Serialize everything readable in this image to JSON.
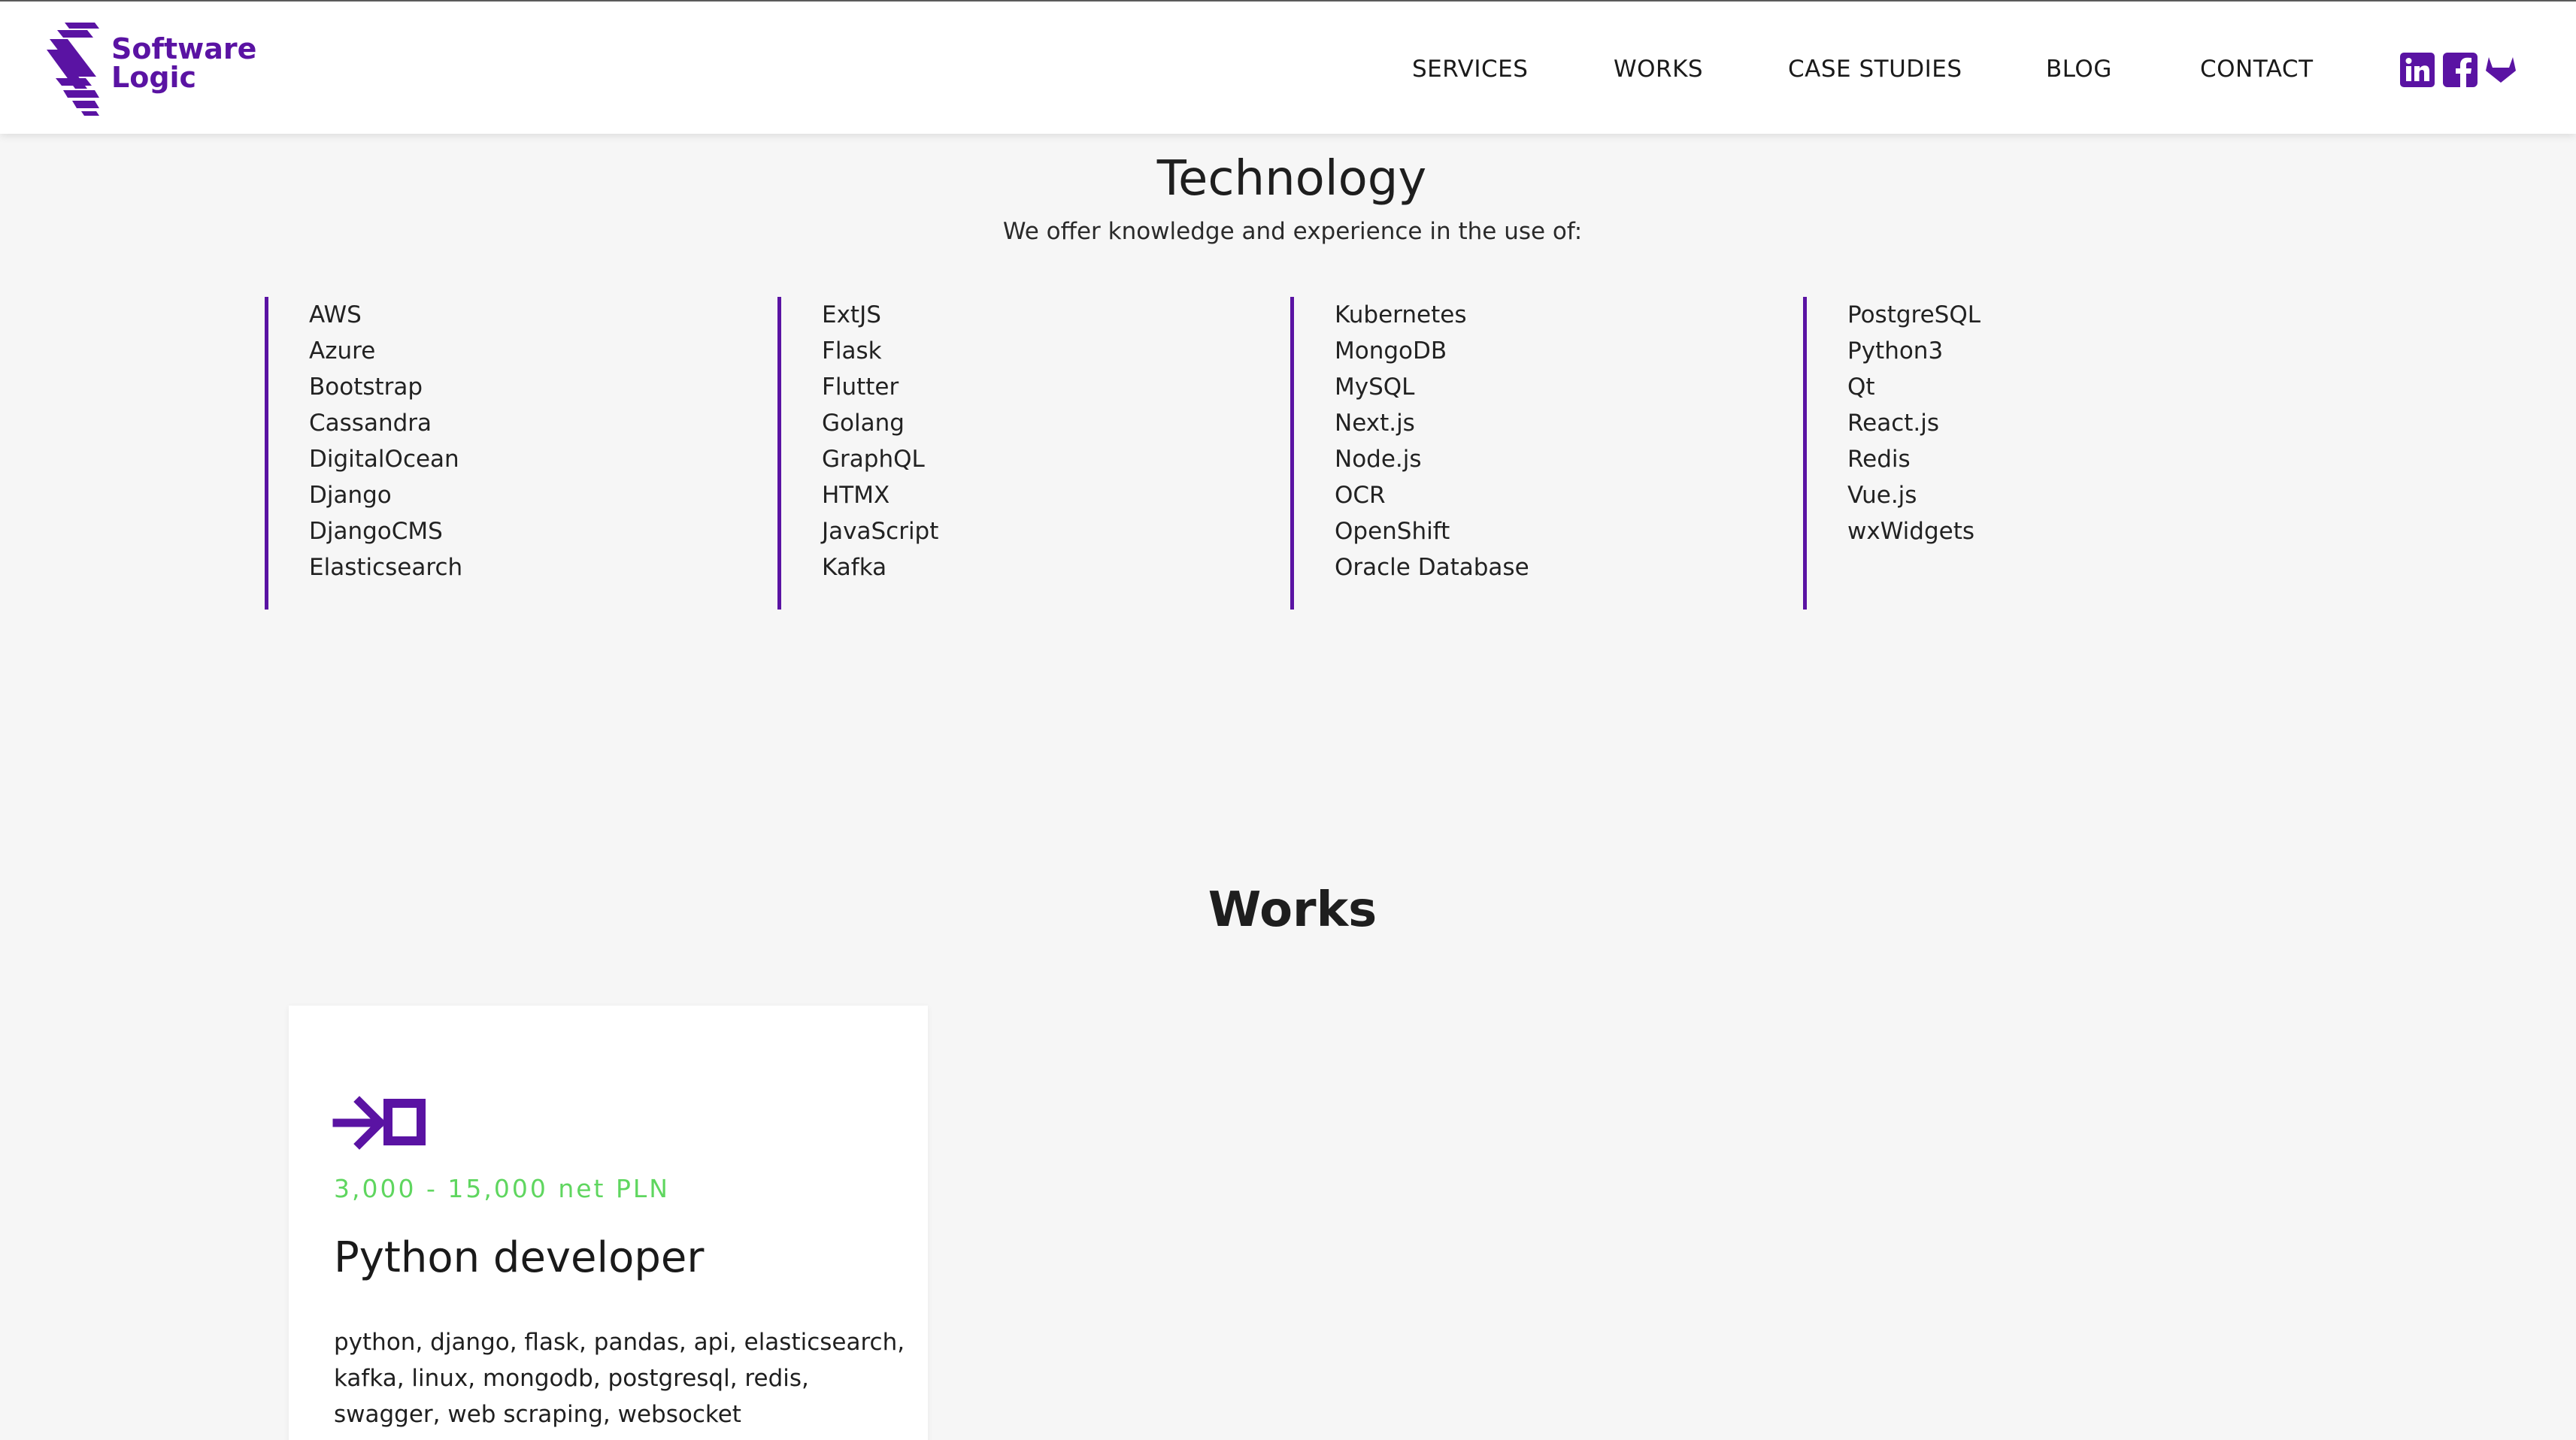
{
  "header": {
    "logo_line1": "Software",
    "logo_line2": "Logic",
    "nav": [
      "SERVICES",
      "WORKS",
      "CASE STUDIES",
      "BLOG",
      "CONTACT"
    ],
    "social": [
      "linkedin-icon",
      "facebook-icon",
      "gitlab-icon"
    ],
    "accent": "#5a13a3"
  },
  "technology": {
    "title": "Technology",
    "subtitle": "We offer knowledge and experience in the use of:",
    "columns": [
      [
        "AWS",
        "Azure",
        "Bootstrap",
        "Cassandra",
        "DigitalOcean",
        "Django",
        "DjangoCMS",
        "Elasticsearch"
      ],
      [
        "ExtJS",
        "Flask",
        "Flutter",
        "Golang",
        "GraphQL",
        "HTMX",
        "JavaScript",
        "Kafka"
      ],
      [
        "Kubernetes",
        "MongoDB",
        "MySQL",
        "Next.js",
        "Node.js",
        "OCR",
        "OpenShift",
        "Oracle Database"
      ],
      [
        "PostgreSQL",
        "Python3",
        "Qt",
        "React.js",
        "Redis",
        "Vue.js",
        "wxWidgets"
      ]
    ]
  },
  "works": {
    "title": "Works",
    "card": {
      "icon": "arrow-box-icon",
      "salary": "3,000 - 15,000 net PLN",
      "salary_color": "#5fd65f",
      "title": "Python developer",
      "tags": "python, django, flask, pandas, api, elasticsearch, kafka, linux, mongodb, postgresql, redis, swagger, web scraping, websocket"
    }
  }
}
